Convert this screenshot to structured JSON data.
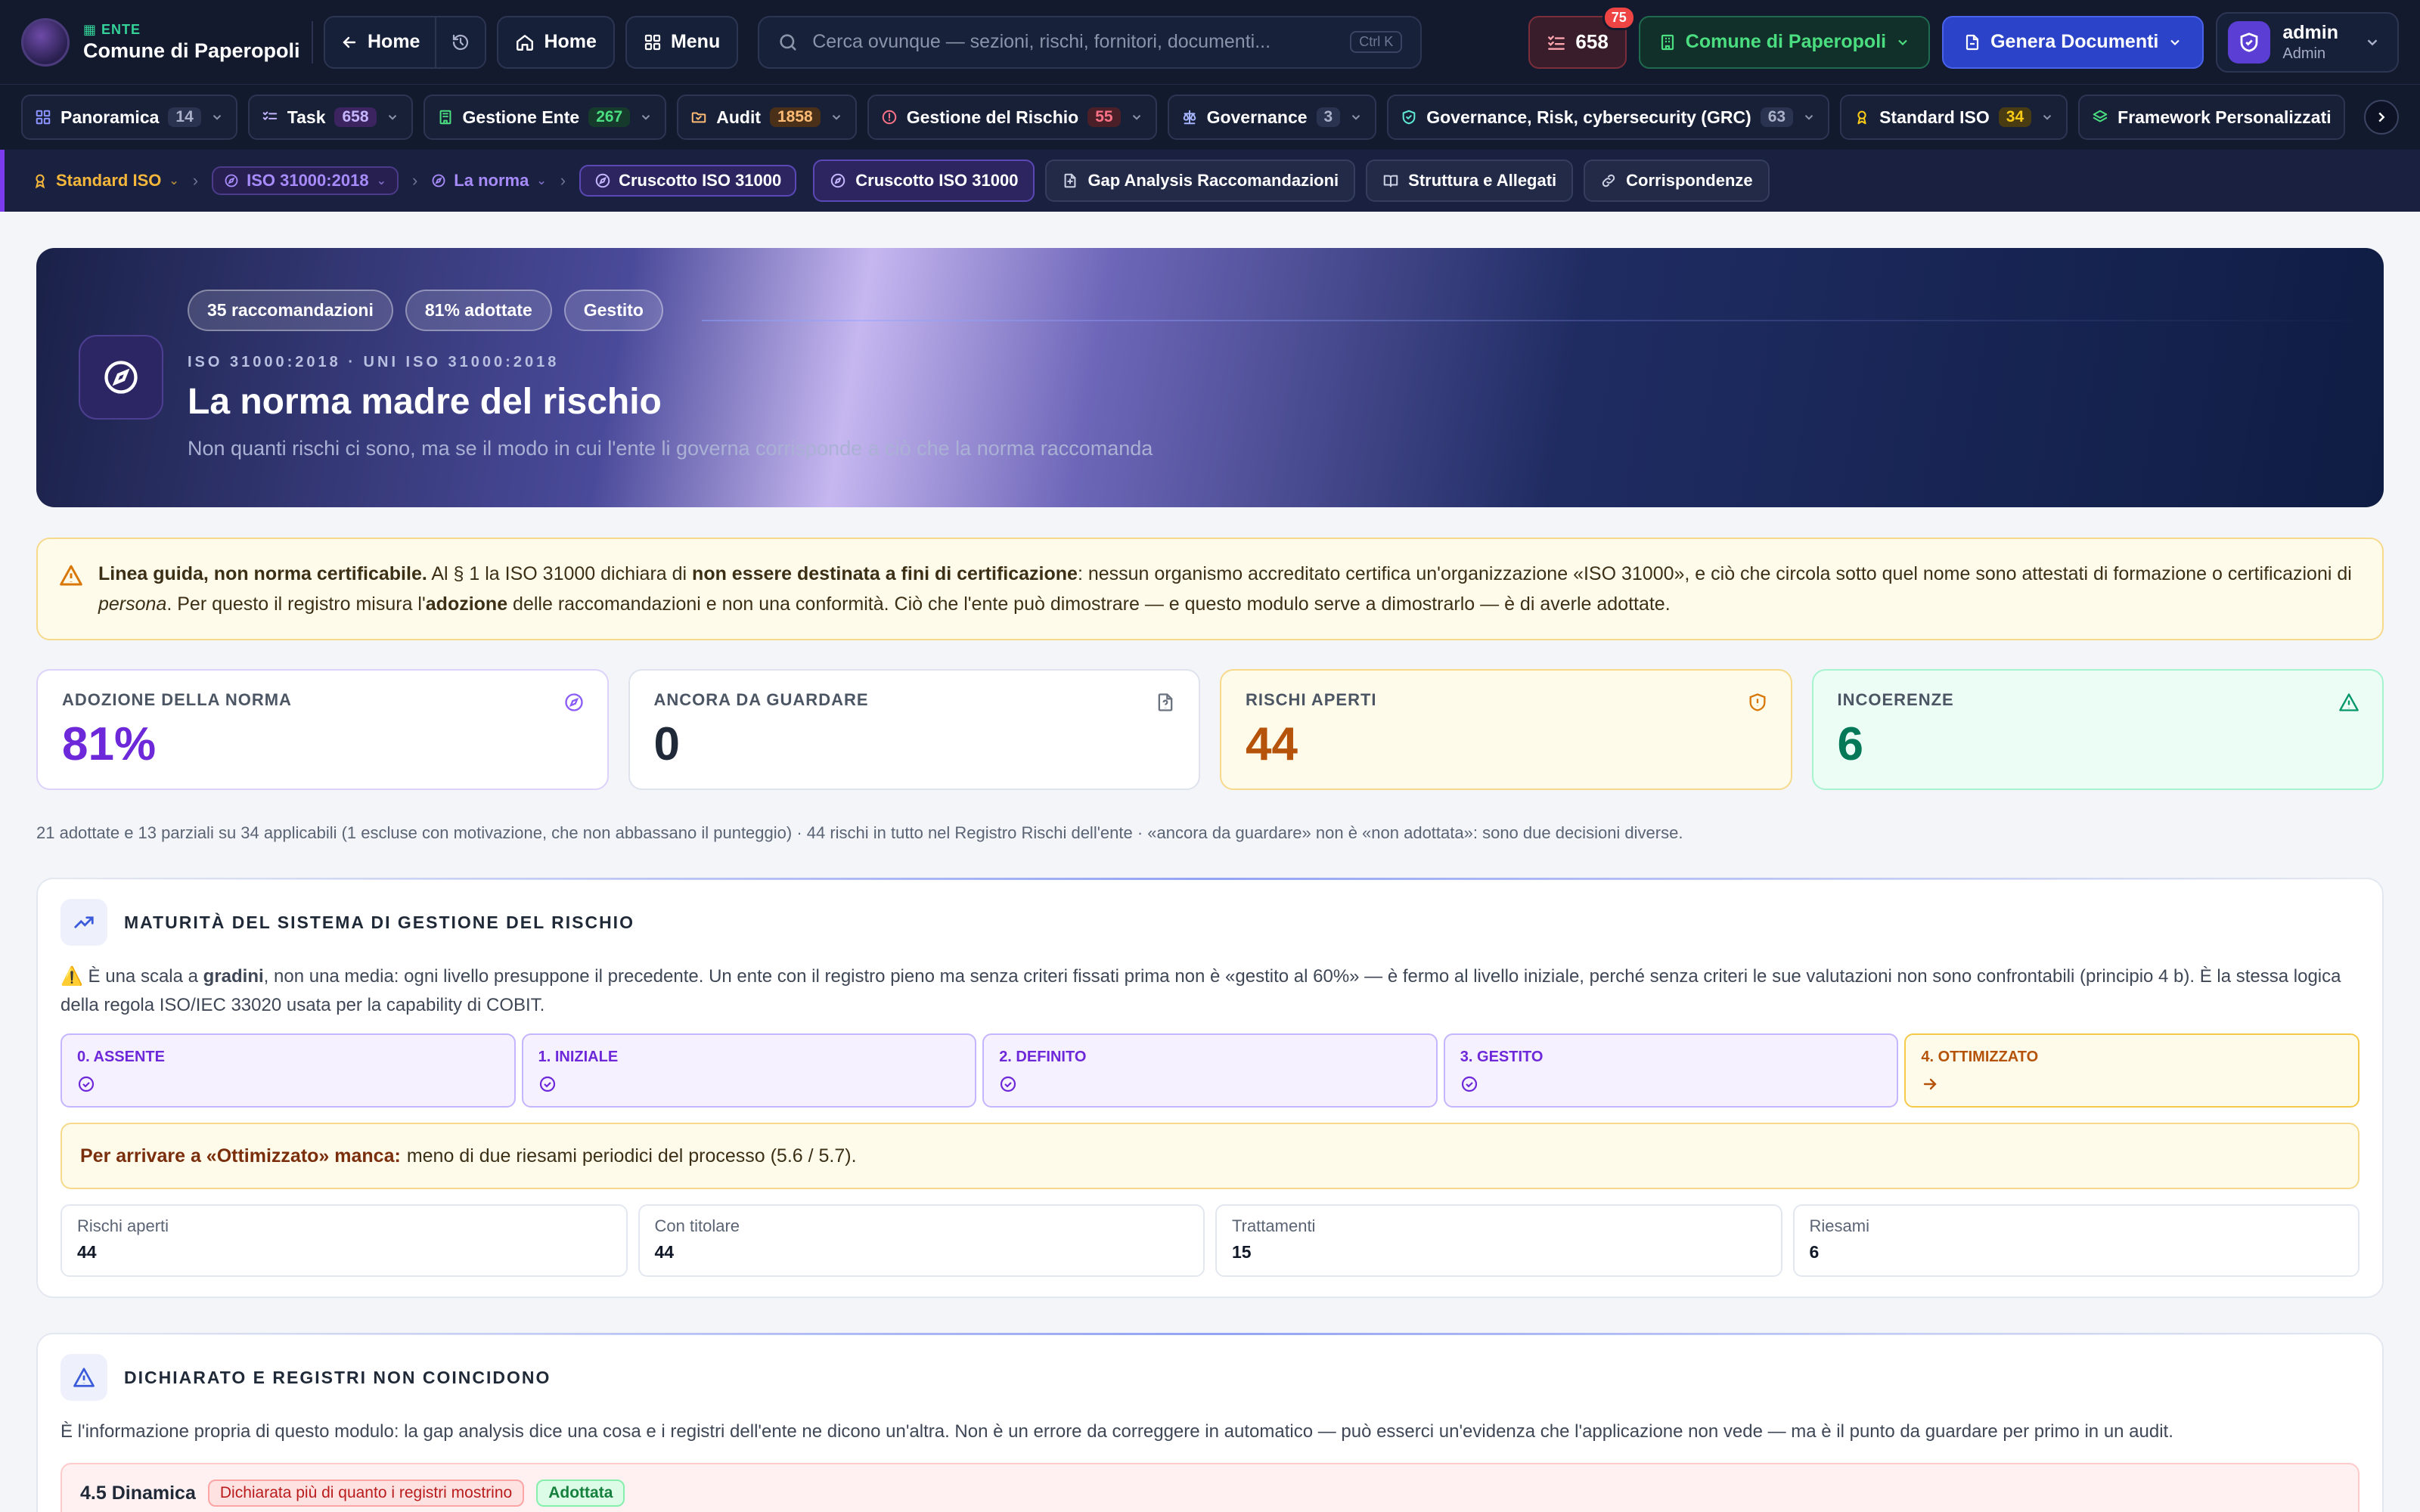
{
  "topbar": {
    "brand_tag": "ENTE",
    "brand_name": "Comune di Paperopoli",
    "back_home": "Home",
    "home": "Home",
    "menu": "Menu",
    "search_placeholder": "Cerca ovunque — sezioni, rischi, fornitori, documenti...",
    "search_shortcut": "Ctrl K",
    "tasks_count": "658",
    "tasks_badge": "75",
    "ente_selector": "Comune di Paperopoli",
    "generate_docs": "Genera Documenti",
    "user_name": "admin",
    "user_role": "Admin"
  },
  "modules": [
    {
      "label": "Panoramica",
      "count": "14",
      "icon": "grid-icon",
      "count_bg": "#2a3350",
      "count_fg": "#aab1c8"
    },
    {
      "label": "Task",
      "count": "658",
      "icon": "checklist-icon",
      "count_bg": "#3b2460",
      "count_fg": "#c4b5fd"
    },
    {
      "label": "Gestione Ente",
      "count": "267",
      "icon": "building-icon",
      "count_bg": "#163b2c",
      "count_fg": "#4ade80"
    },
    {
      "label": "Audit",
      "count": "1858",
      "icon": "folder-icon",
      "count_bg": "#4a3018",
      "count_fg": "#fdba74"
    },
    {
      "label": "Gestione del Rischio",
      "count": "55",
      "icon": "alert-circle-icon",
      "count_bg": "#4a1f28",
      "count_fg": "#fb7185"
    },
    {
      "label": "Governance",
      "count": "3",
      "icon": "scale-icon",
      "count_bg": "#2a3350",
      "count_fg": "#aab1c8"
    },
    {
      "label": "Governance, Risk, cybersecurity (GRC)",
      "count": "63",
      "icon": "shield-check-icon",
      "count_bg": "#2a3350",
      "count_fg": "#aab1c8"
    },
    {
      "label": "Standard ISO",
      "count": "34",
      "icon": "award-icon",
      "count_bg": "#4a3c12",
      "count_fg": "#facc15"
    },
    {
      "label": "Framework Personalizzati",
      "count": "",
      "icon": "layers-icon",
      "count_bg": "",
      "count_fg": ""
    }
  ],
  "subnav": {
    "crumb_standard": "Standard ISO",
    "crumb_iso": "ISO 31000:2018",
    "crumb_norma": "La norma",
    "crumb_current": "Cruscotto ISO 31000",
    "tabs": [
      {
        "label": "Cruscotto ISO 31000",
        "icon": "compass-icon",
        "active": true
      },
      {
        "label": "Gap Analysis Raccomandazioni",
        "icon": "file-diff-icon",
        "active": false
      },
      {
        "label": "Struttura e Allegati",
        "icon": "book-icon",
        "active": false
      },
      {
        "label": "Corrispondenze",
        "icon": "link-icon",
        "active": false
      }
    ]
  },
  "hero": {
    "pills": [
      "35 raccomandazioni",
      "81% adottate",
      "Gestito"
    ],
    "kicker": "ISO 31000:2018 · UNI ISO 31000:2018",
    "title": "La norma madre del rischio",
    "subtitle": "Non quanti rischi ci sono, ma se il modo in cui l'ente li governa corrisponde a ciò che la norma raccomanda"
  },
  "alert": {
    "bold1": "Linea guida, non norma certificabile.",
    "text1": " Al § 1 la ISO 31000 dichiara di ",
    "bold2": "non essere destinata a fini di certificazione",
    "text2": ": nessun organismo accreditato certifica un'organizzazione «ISO 31000», e ciò che circola sotto quel nome sono attestati di formazione o certificazioni di ",
    "italic": "persona",
    "text3": ". Per questo il registro misura l'",
    "bold3": "adozione",
    "text4": " delle raccomandazioni e non una conformità. Ciò che l'ente può dimostrare — e questo modulo serve a dimostrarlo — è di averle adottate."
  },
  "kpis": [
    {
      "label": "ADOZIONE DELLA NORMA",
      "value": "81%",
      "icon": "compass-icon"
    },
    {
      "label": "ANCORA DA GUARDARE",
      "value": "0",
      "icon": "file-question-icon"
    },
    {
      "label": "RISCHI APERTI",
      "value": "44",
      "icon": "shield-alert-icon"
    },
    {
      "label": "INCOERENZE",
      "value": "6",
      "icon": "triangle-alert-icon"
    }
  ],
  "summary_note": "21 adottate e 13 parziali su 34 applicabili (1 escluse con motivazione, che non abbassano il punteggio) · 44 rischi in tutto nel Registro Rischi dell'ente · «ancora da guardare» non è «non adottata»: sono due decisioni diverse.",
  "maturity": {
    "title": "MATURITÀ DEL SISTEMA DI GESTIONE DEL RISCHIO",
    "text_a": "⚠️ È una scala a ",
    "text_bold": "gradini",
    "text_b": ", non una media: ogni livello presuppone il precedente. Un ente con il registro pieno ma senza criteri fissati prima non è «gestito al 60%» — è fermo al livello iniziale, perché senza criteri le sue valutazioni non sono confrontabili (principio 4 b). È la stessa logica della regola ISO/IEC 33020 usata per la capability di COBIT.",
    "levels": [
      {
        "label": "0. ASSENTE",
        "state": "done"
      },
      {
        "label": "1. INIZIALE",
        "state": "done"
      },
      {
        "label": "2. DEFINITO",
        "state": "done"
      },
      {
        "label": "3. GESTITO",
        "state": "done"
      },
      {
        "label": "4. OTTIMIZZATO",
        "state": "next"
      }
    ],
    "missing_label": "Per arrivare a «Ottimizzato» manca:",
    "missing_text": "meno di due riesami periodici del processo (5.6 / 5.7).",
    "stats": [
      {
        "label": "Rischi aperti",
        "value": "44"
      },
      {
        "label": "Con titolare",
        "value": "44"
      },
      {
        "label": "Trattamenti",
        "value": "15"
      },
      {
        "label": "Riesami",
        "value": "6"
      }
    ]
  },
  "mismatch": {
    "title": "DICHIARATO E REGISTRI NON COINCIDONO",
    "text": "È l'informazione propria di questo modulo: la gap analysis dice una cosa e i registri dell'ente ne dicono un'altra. Non è un errore da correggere in automatico — può esserci un'evidenza che l'applicazione non vede — ma è il punto da guardare per primo in un audit.",
    "row_code": "4.5 Dinamica",
    "row_tag_red": "Dichiarata più di quanto i registri mostrino",
    "row_tag_green": "Adottata"
  }
}
